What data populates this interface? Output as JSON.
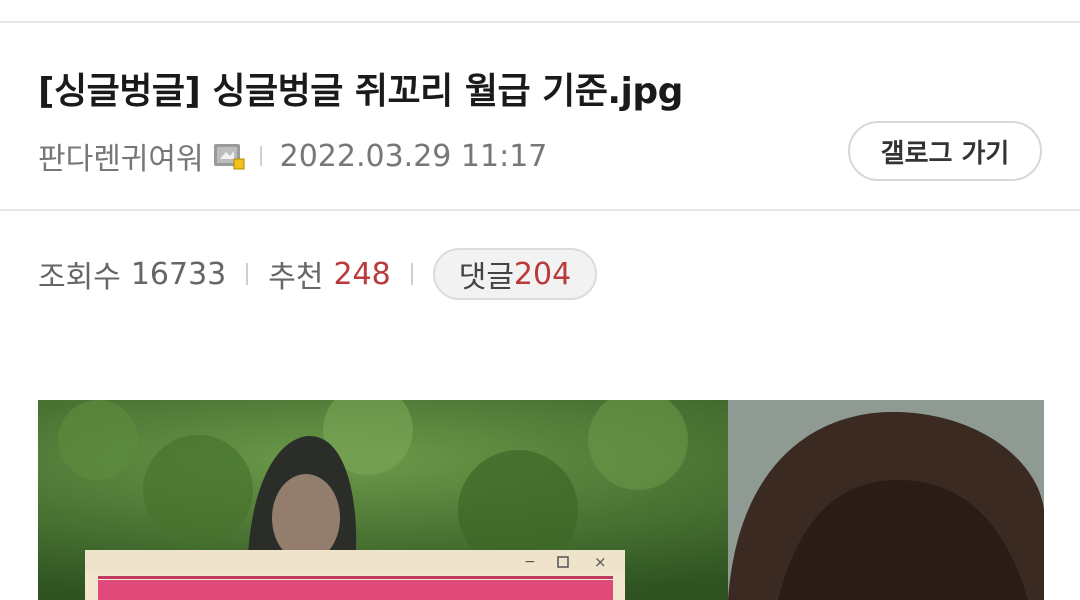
{
  "post": {
    "title": "[싱글벙글] 싱글벙글 쥐꼬리 월급 기준.jpg",
    "author": "판다렌귀여워",
    "author_level_icon": "gallery-level-icon",
    "date": "2022.03.29 11:17",
    "gallery_button": "갤로그 가기"
  },
  "stats": {
    "views_label": "조회수",
    "views": "16733",
    "recommend_label": "추천",
    "recommend": "248",
    "comments_label": "댓글",
    "comments": "204"
  },
  "colors": {
    "accent_red": "#b83a3a",
    "divider": "#e6e6e6"
  },
  "image": {
    "description_icon": "post-photo"
  }
}
